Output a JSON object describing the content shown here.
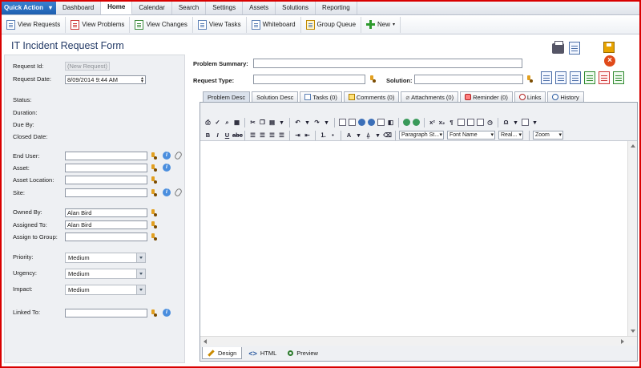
{
  "topnav": {
    "quick_action": "Quick Action",
    "items": [
      "Dashboard",
      "Home",
      "Calendar",
      "Search",
      "Settings",
      "Assets",
      "Solutions",
      "Reporting"
    ]
  },
  "ribbon": {
    "view_requests": "View Requests",
    "view_problems": "View Problems",
    "view_changes": "View Changes",
    "view_tasks": "View Tasks",
    "whiteboard": "Whiteboard",
    "group_queue": "Group Queue",
    "new": "New"
  },
  "page": {
    "title": "IT Incident Request Form"
  },
  "left": {
    "request_id_label": "Request Id:",
    "request_id_value": "(New Request)",
    "request_date_label": "Request Date:",
    "request_date_value": "8/09/2014 9:44 AM",
    "status_label": "Status:",
    "duration_label": "Duration:",
    "due_by_label": "Due By:",
    "closed_date_label": "Closed Date:",
    "end_user_label": "End User:",
    "asset_label": "Asset:",
    "asset_location_label": "Asset Location:",
    "site_label": "Site:",
    "owned_by_label": "Owned By:",
    "owned_by_value": "Alan Bird",
    "assigned_to_label": "Assigned To:",
    "assigned_to_value": "Alan Bird",
    "assign_group_label": "Assign to Group:",
    "priority_label": "Priority:",
    "priority_value": "Medium",
    "urgency_label": "Urgency:",
    "urgency_value": "Medium",
    "impact_label": "Impact:",
    "impact_value": "Medium",
    "linked_to_label": "Linked To:"
  },
  "right": {
    "problem_summary_label": "Problem Summary:",
    "request_type_label": "Request Type:",
    "solution_label": "Solution:"
  },
  "tabs": {
    "problem_desc": "Problem Desc",
    "solution_desc": "Solution Desc",
    "tasks": "Tasks (0)",
    "comments": "Comments (0)",
    "attachments": "Attachments (0)",
    "reminder": "Reminder (0)",
    "links": "Links",
    "history": "History"
  },
  "editor": {
    "paragraph_style": "Paragraph St...",
    "font_name": "Font Name",
    "font_size": "Real...",
    "zoom": "Zoom",
    "mode_design": "Design",
    "mode_html": "HTML",
    "mode_preview": "Preview"
  },
  "colors": {
    "accent": "#1e5fb0",
    "frame": "#d90000",
    "title": "#233a66"
  }
}
